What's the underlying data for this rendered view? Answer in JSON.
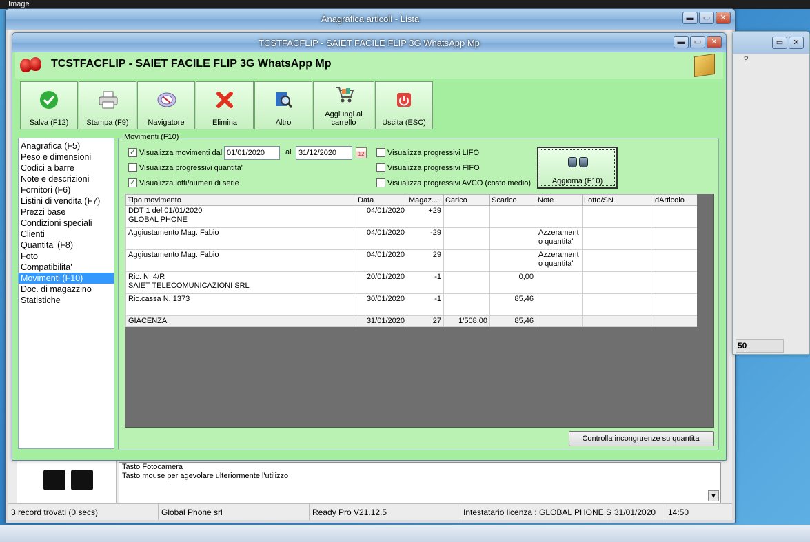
{
  "viewer": {
    "title": "Image"
  },
  "back_window": {
    "title": "Anagrafica articoli - Lista",
    "description_lines": [
      "Tasto Fotocamera",
      "Tasto mouse per agevolare ulteriormente l'utilizzo"
    ],
    "status": {
      "records": "3 record trovati (0 secs)",
      "company": "Global Phone srl",
      "version": "Ready Pro V21.12.5",
      "license": "Intestatario licenza : GLOBAL PHONE S",
      "date": "31/01/2020",
      "time": "14:50"
    }
  },
  "right_window": {
    "help_mark": "?",
    "value": "50"
  },
  "window_buttons": {
    "minimize": "▬",
    "maximize": "▭",
    "close": "✕"
  },
  "dialog": {
    "title": "TCSTFACFLIP - SAIET FACILE FLIP 3G WhatsApp Mp",
    "header_name": "TCSTFACFLIP - SAIET FACILE FLIP 3G WhatsApp Mp",
    "toolbar": [
      {
        "label": "Salva (F12)",
        "icon": "check-icon"
      },
      {
        "label": "Stampa (F9)",
        "icon": "printer-icon"
      },
      {
        "label": "Navigatore",
        "icon": "compass-icon"
      },
      {
        "label": "Elimina",
        "icon": "delete-x-icon"
      },
      {
        "label": "Altro",
        "icon": "magnifier-icon"
      },
      {
        "label": "Aggiungi al carrello",
        "icon": "cart-icon"
      },
      {
        "label": "Uscita (ESC)",
        "icon": "exit-icon"
      }
    ],
    "nav_items": [
      "Anagrafica (F5)",
      "Peso e dimensioni",
      "Codici a barre",
      "Note e descrizioni",
      "Fornitori (F6)",
      "Listini di vendita (F7)",
      "Prezzi base",
      "Condizioni speciali",
      "Clienti",
      "Quantita' (F8)",
      "Foto",
      "Compatibilita'",
      "Movimenti (F10)",
      "Doc. di magazzino",
      "Statistiche"
    ],
    "selected_nav": "Movimenti (F10)",
    "movements": {
      "legend": "Movimenti (F10)",
      "show_movements_label": "Visualizza movimenti dal",
      "show_movements_checked": true,
      "date_from": "01/01/2020",
      "al_label": "al",
      "date_to": "31/12/2020",
      "progressive_qty_label": "Visualizza progressivi quantita'",
      "progressive_qty_checked": false,
      "lots_label": "Visualizza lotti/numeri di serie",
      "lots_checked": true,
      "lifo_label": "Visualizza progressivi LIFO",
      "lifo_checked": false,
      "fifo_label": "Visualizza progressivi FIFO",
      "fifo_checked": false,
      "avco_label": "Visualizza progressivi AVCO (costo medio)",
      "avco_checked": false,
      "refresh_label": "Aggiorna (F10)",
      "check_button": "Controlla incongruenze su quantita'",
      "columns": [
        "Tipo movimento",
        "Data",
        "Magaz...",
        "Carico",
        "Scarico",
        "Note",
        "Lotto/SN",
        "IdArticolo"
      ],
      "rows": [
        {
          "tipo": [
            "DDT 1 del 01/01/2020",
            "GLOBAL PHONE"
          ],
          "data": "04/01/2020",
          "magaz": "+29",
          "carico": "",
          "scarico": "",
          "note": [
            ""
          ],
          "lotto": "",
          "id": ""
        },
        {
          "tipo": [
            "Aggiustamento Mag. Fabio"
          ],
          "data": "04/01/2020",
          "magaz": "-29",
          "carico": "",
          "scarico": "",
          "note": [
            "Azzerament",
            "o quantita'"
          ],
          "lotto": "",
          "id": ""
        },
        {
          "tipo": [
            "Aggiustamento Mag. Fabio"
          ],
          "data": "04/01/2020",
          "magaz": "29",
          "carico": "",
          "scarico": "",
          "note": [
            "Azzerament",
            "o quantita'"
          ],
          "lotto": "",
          "id": ""
        },
        {
          "tipo": [
            "Ric. N. 4/R",
            "SAIET TELECOMUNICAZIONI SRL"
          ],
          "data": "20/01/2020",
          "magaz": "-1",
          "carico": "",
          "scarico": "0,00",
          "note": [
            ""
          ],
          "lotto": "",
          "id": ""
        },
        {
          "tipo": [
            "Ric.cassa N. 1373"
          ],
          "data": "30/01/2020",
          "magaz": "-1",
          "carico": "",
          "scarico": "85,46",
          "note": [
            ""
          ],
          "lotto": "",
          "id": ""
        }
      ],
      "total": {
        "tipo": "GIACENZA",
        "data": "31/01/2020",
        "magaz": "27",
        "carico": "1'508,00",
        "scarico": "85,46"
      }
    }
  }
}
